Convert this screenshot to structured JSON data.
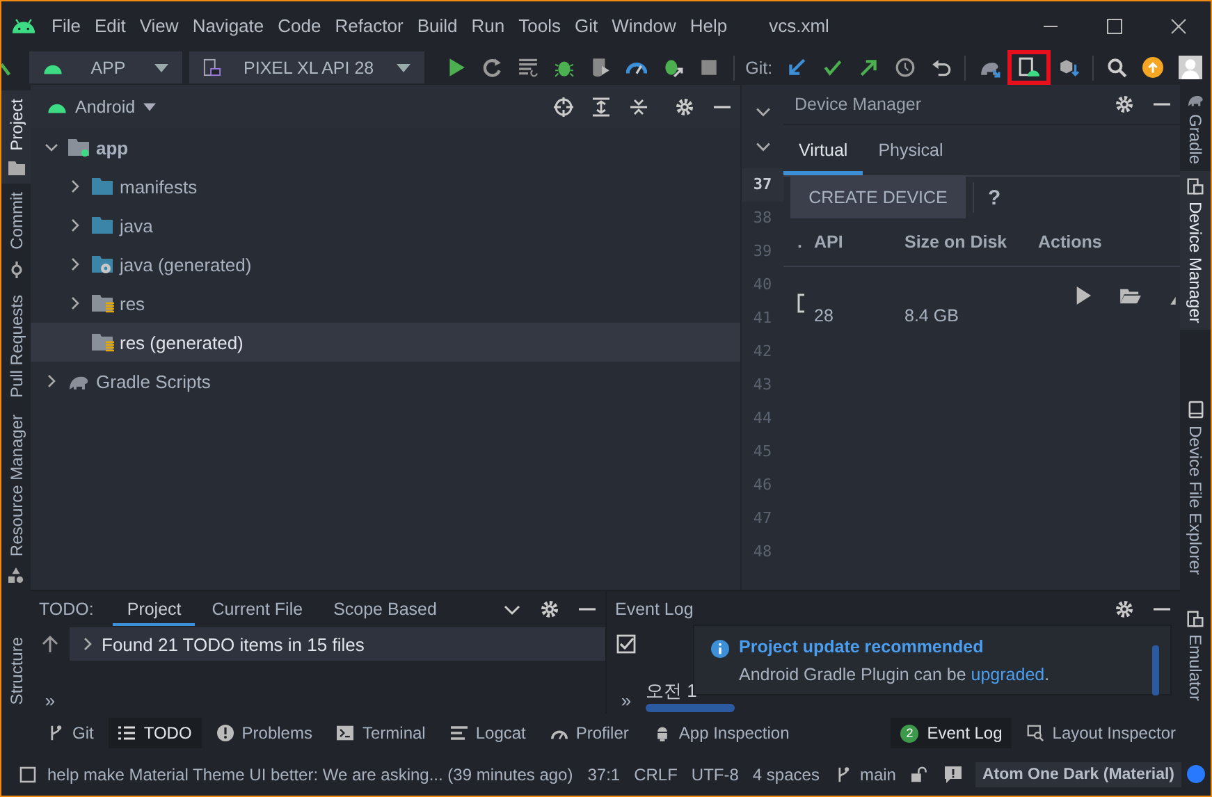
{
  "menu": [
    "File",
    "Edit",
    "View",
    "Navigate",
    "Code",
    "Refactor",
    "Build",
    "Run",
    "Tools",
    "Git",
    "Window",
    "Help"
  ],
  "file_title": "vcs.xml",
  "toolbar": {
    "run_config": "APP",
    "device": "PIXEL XL API 28",
    "git_label": "Git:"
  },
  "left_stripe": [
    {
      "label": "Project",
      "selected": true,
      "kind": "folder"
    },
    {
      "label": "Commit",
      "selected": false,
      "kind": "commit"
    },
    {
      "label": "Pull Requests",
      "selected": false,
      "kind": "none"
    },
    {
      "label": "Resource Manager",
      "selected": false,
      "kind": "resources"
    }
  ],
  "left_stripe_bottom": [
    {
      "label": "Structure",
      "selected": false
    }
  ],
  "project_panel": {
    "view": "Android",
    "tree": [
      {
        "label": "app",
        "kind": "module",
        "expanded": true,
        "selected": false,
        "children": [
          {
            "label": "manifests",
            "kind": "folder",
            "expanded": false,
            "selected": false
          },
          {
            "label": "java",
            "kind": "folder",
            "expanded": false,
            "selected": false
          },
          {
            "label": "java (generated)",
            "kind": "generated",
            "expanded": false,
            "selected": false
          },
          {
            "label": "res",
            "kind": "res",
            "expanded": false,
            "selected": false
          },
          {
            "label": "res (generated)",
            "kind": "res",
            "selected": true
          }
        ]
      },
      {
        "label": "Gradle Scripts",
        "kind": "gradle",
        "expanded": false,
        "selected": false
      }
    ]
  },
  "gutter": [
    {
      "n": "37",
      "selected": true
    },
    {
      "n": "38",
      "selected": false
    },
    {
      "n": "39",
      "selected": false
    },
    {
      "n": "40",
      "selected": false
    },
    {
      "n": "41",
      "selected": false
    },
    {
      "n": "42",
      "selected": false
    },
    {
      "n": "43",
      "selected": false
    },
    {
      "n": "44",
      "selected": false
    },
    {
      "n": "45",
      "selected": false
    },
    {
      "n": "46",
      "selected": false
    },
    {
      "n": "47",
      "selected": false
    },
    {
      "n": "48",
      "selected": false
    }
  ],
  "device_manager": {
    "title": "Device Manager",
    "tabs": [
      {
        "label": "Virtual",
        "selected": true
      },
      {
        "label": "Physical",
        "selected": false
      }
    ],
    "create_button": "CREATE DEVICE",
    "help": "?",
    "columns": [
      ".",
      "API",
      "Size on Disk",
      "Actions"
    ],
    "rows": [
      {
        "api": "28",
        "size": "8.4 GB"
      }
    ]
  },
  "right_stripe": [
    {
      "label": "Gradle",
      "selected": false,
      "kind": "gradle"
    },
    {
      "label": "Device Manager",
      "selected": true,
      "kind": "devices"
    },
    {
      "label": "Device File Explorer",
      "selected": false,
      "kind": "phone"
    }
  ],
  "right_stripe_bottom": [
    {
      "label": "Emulator",
      "selected": false,
      "kind": "devices"
    }
  ],
  "todo": {
    "label": "TODO:",
    "tabs": [
      {
        "label": "Project",
        "selected": true
      },
      {
        "label": "Current File",
        "selected": false
      },
      {
        "label": "Scope Based",
        "selected": false
      }
    ],
    "summary": "Found 21 TODO items in 15 files",
    "more": "»"
  },
  "event_log": {
    "title": "Event Log",
    "entry": "오전 1",
    "more": "»",
    "notification": {
      "title": "Project update recommended",
      "text": "Android Gradle Plugin can be ",
      "link": "upgraded",
      "end": "."
    }
  },
  "tool_windows": [
    {
      "label": "Git",
      "kind": "branch",
      "selected": false
    },
    {
      "label": "TODO",
      "kind": "list",
      "selected": true
    },
    {
      "label": "Problems",
      "kind": "problems",
      "selected": false
    },
    {
      "label": "Terminal",
      "kind": "terminal",
      "selected": false
    },
    {
      "label": "Logcat",
      "kind": "logcat",
      "selected": false
    },
    {
      "label": "Profiler",
      "kind": "gauge",
      "selected": false
    },
    {
      "label": "App Inspection",
      "kind": "inspect",
      "selected": false
    }
  ],
  "tool_windows_right": [
    {
      "label": "Event Log",
      "kind": "badge",
      "badge": "2",
      "selected": true
    },
    {
      "label": "Layout Inspector",
      "kind": "layout",
      "selected": false
    }
  ],
  "status": {
    "message": "help make Material Theme UI better: We are asking... (39 minutes ago)",
    "position": "37:1",
    "line_separator": "CRLF",
    "encoding": "UTF-8",
    "indent": "4 spaces",
    "branch": "main",
    "theme": "Atom One Dark (Material)"
  }
}
